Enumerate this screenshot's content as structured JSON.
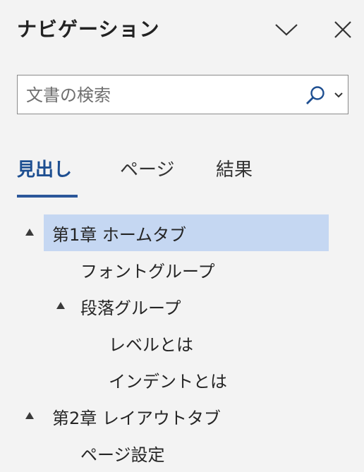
{
  "pane": {
    "title": "ナビゲーション",
    "dropdown_icon": "chevron-down-icon",
    "close_icon": "close-icon"
  },
  "search": {
    "value": "",
    "placeholder": "文書の検索",
    "search_icon": "magnifier-icon",
    "options_icon": "chevron-down-icon"
  },
  "tabs": [
    {
      "label": "見出し",
      "active": true
    },
    {
      "label": "ページ",
      "active": false
    },
    {
      "label": "結果",
      "active": false
    }
  ],
  "headings": [
    {
      "label": "第1章 ホームタブ",
      "level": 1,
      "expanded": true,
      "selected": true
    },
    {
      "label": "フォントグループ",
      "level": 2,
      "expanded": null,
      "selected": false
    },
    {
      "label": "段落グループ",
      "level": 2,
      "expanded": true,
      "selected": false
    },
    {
      "label": "レベルとは",
      "level": 3,
      "expanded": null,
      "selected": false
    },
    {
      "label": "インデントとは",
      "level": 3,
      "expanded": null,
      "selected": false
    },
    {
      "label": "第2章 レイアウトタブ",
      "level": 1,
      "expanded": true,
      "selected": false
    },
    {
      "label": "ページ設定",
      "level": 2,
      "expanded": null,
      "selected": false
    }
  ],
  "colors": {
    "accent": "#2b579a",
    "selection": "#c5d7f2",
    "background": "#f3f3f3"
  }
}
